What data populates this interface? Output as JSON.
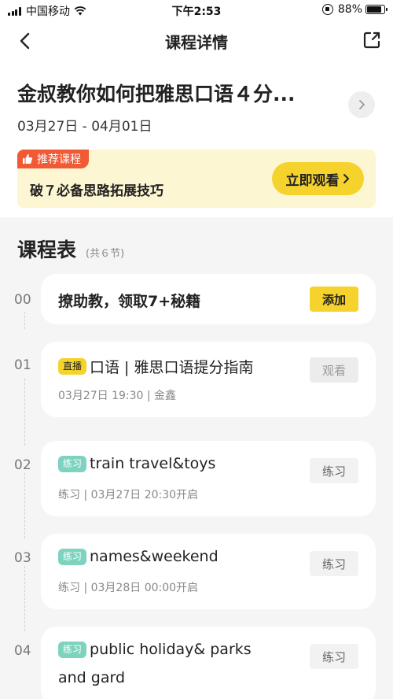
{
  "status_bar": {
    "carrier": "中国移动",
    "time": "下午2:53",
    "battery_pct": "88%",
    "battery_level": 0.88
  },
  "nav": {
    "title": "课程详情",
    "back_icon": "chevron-left-icon",
    "share_icon": "share-icon"
  },
  "course": {
    "title": "金叔教你如何把雅思口语４分...",
    "dates": "03月27日 - 04月01日"
  },
  "promo": {
    "tag": "推荐课程",
    "text": "破７必备思路拓展技巧",
    "button": "立即观看"
  },
  "schedule": {
    "title": "课程表",
    "count": "(共６节)",
    "lessons": [
      {
        "num": "00",
        "title": "撩助教，领取7+秘籍",
        "button": "添加"
      },
      {
        "num": "01",
        "badge": "直播",
        "title": "口语 | 雅思口语提分指南",
        "sub": "03月27日 19:30 | 金鑫",
        "button": "观看"
      },
      {
        "num": "02",
        "badge": "练习",
        "title": "train travel&toys",
        "sub": "练习 | 03月27日 20:30开启",
        "button": "练习"
      },
      {
        "num": "03",
        "badge": "练习",
        "title": "names&weekend",
        "sub": "练习 | 03月28日 00:00开启",
        "button": "练习"
      },
      {
        "num": "04",
        "badge": "练习",
        "title": "public holiday& parks",
        "title2": "and gard",
        "button": "练习"
      }
    ]
  },
  "colors": {
    "accent_yellow": "#f5d32c",
    "promo_bg": "#fdf6d2",
    "tag_red": "#f05a34",
    "practice_green": "#7ed3bf"
  }
}
